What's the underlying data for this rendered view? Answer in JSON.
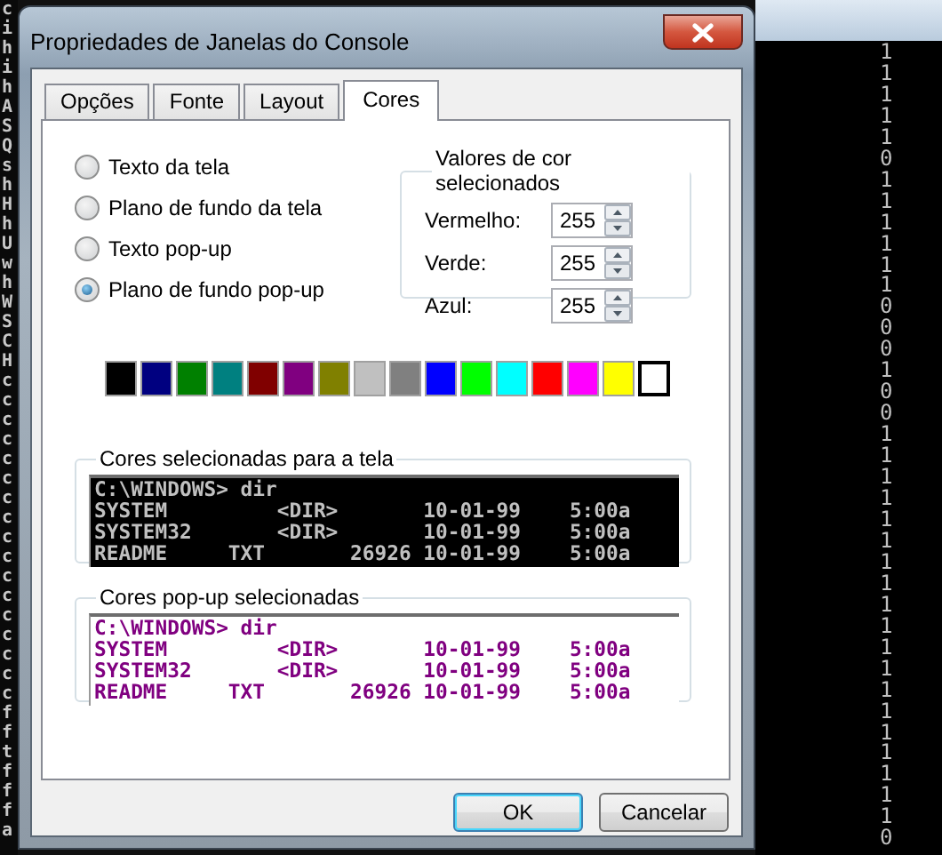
{
  "console_left_column": [
    "c",
    "i",
    "h",
    "i",
    "h",
    "A",
    "S",
    "Q",
    "s",
    "h",
    "H",
    "h",
    "U",
    "w",
    "h",
    "W",
    "S",
    "C",
    "H",
    "c",
    "c",
    "c",
    "c",
    "c",
    "c",
    "c",
    "c",
    "c",
    "c",
    "c",
    "c",
    "c",
    "c",
    "c",
    "c",
    "c",
    "f",
    "f",
    "t",
    "f",
    "f",
    "f",
    "a"
  ],
  "console_right_column": [
    "1",
    "1",
    "1",
    "1",
    "1",
    "0",
    "1",
    "1",
    "1",
    "1",
    "1",
    "1",
    "0",
    "0",
    "0",
    "1",
    "0",
    "0",
    "1",
    "1",
    "1",
    "1",
    "1",
    "1",
    "1",
    "1",
    "1",
    "1",
    "1",
    "1",
    "1",
    "1",
    "1",
    "1",
    "1",
    "1",
    "1",
    "0"
  ],
  "window": {
    "title": "Propriedades de Janelas do Console"
  },
  "tabs": [
    {
      "label": "Opções",
      "selected": false
    },
    {
      "label": "Fonte",
      "selected": false
    },
    {
      "label": "Layout",
      "selected": false
    },
    {
      "label": "Cores",
      "selected": true
    }
  ],
  "color_targets": [
    {
      "label": "Texto da tela",
      "selected": false
    },
    {
      "label": "Plano de fundo da tela",
      "selected": false
    },
    {
      "label": "Texto pop-up",
      "selected": false
    },
    {
      "label": "Plano de fundo pop-up",
      "selected": true
    }
  ],
  "color_values": {
    "title": "Valores de cor selecionados",
    "fields": [
      {
        "label": "Vermelho:",
        "value": "255"
      },
      {
        "label": "Verde:",
        "value": "255"
      },
      {
        "label": "Azul:",
        "value": "255"
      }
    ]
  },
  "palette": [
    {
      "color": "#000000",
      "selected": false
    },
    {
      "color": "#000080",
      "selected": false
    },
    {
      "color": "#008000",
      "selected": false
    },
    {
      "color": "#008080",
      "selected": false
    },
    {
      "color": "#800000",
      "selected": false
    },
    {
      "color": "#800080",
      "selected": false
    },
    {
      "color": "#808000",
      "selected": false
    },
    {
      "color": "#c0c0c0",
      "selected": false
    },
    {
      "color": "#808080",
      "selected": false
    },
    {
      "color": "#0000ff",
      "selected": false
    },
    {
      "color": "#00ff00",
      "selected": false
    },
    {
      "color": "#00ffff",
      "selected": false
    },
    {
      "color": "#ff0000",
      "selected": false
    },
    {
      "color": "#ff00ff",
      "selected": false
    },
    {
      "color": "#ffff00",
      "selected": false
    },
    {
      "color": "#ffffff",
      "selected": true
    }
  ],
  "previews": [
    {
      "kind": "screen",
      "title": "Cores selecionadas para a tela",
      "lines": [
        "C:\\WINDOWS> dir",
        "SYSTEM         <DIR>       10-01-99    5:00a",
        "SYSTEM32       <DIR>       10-01-99    5:00a",
        "README     TXT       26926 10-01-99    5:00a"
      ]
    },
    {
      "kind": "popup",
      "title": "Cores pop-up selecionadas",
      "lines": [
        "C:\\WINDOWS> dir",
        "SYSTEM         <DIR>       10-01-99    5:00a",
        "SYSTEM32       <DIR>       10-01-99    5:00a",
        "README     TXT       26926 10-01-99    5:00a"
      ]
    }
  ],
  "buttons": [
    {
      "label": "OK",
      "default": true
    },
    {
      "label": "Cancelar",
      "default": false
    }
  ]
}
